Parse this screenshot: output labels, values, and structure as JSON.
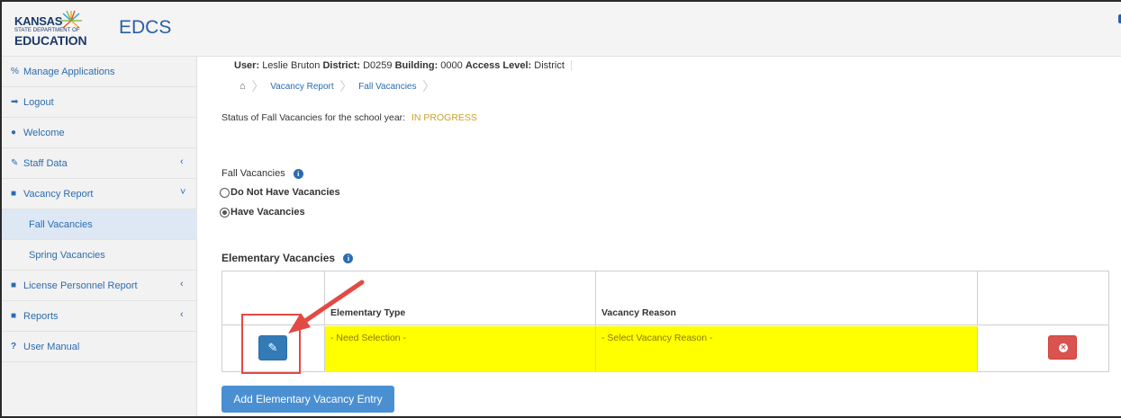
{
  "header": {
    "logo": {
      "line1": "KANSAS",
      "line2": "STATE DEPARTMENT OF",
      "line3": "EDUCATION"
    },
    "app_title": "EDCS"
  },
  "sidebar": {
    "items": [
      {
        "label": "Manage Applications",
        "icon": "link-icon"
      },
      {
        "label": "Logout",
        "icon": "sign-out-icon"
      },
      {
        "label": "Welcome",
        "icon": "users-icon"
      },
      {
        "label": "Staff Data",
        "icon": "pencil-icon",
        "chevron": "‹"
      },
      {
        "label": "Vacancy Report",
        "icon": "folder-icon",
        "chevron": "˅"
      },
      {
        "label": "Fall Vacancies",
        "active": true
      },
      {
        "label": "Spring Vacancies"
      },
      {
        "label": "License Personnel Report",
        "icon": "folder-icon",
        "chevron": "‹"
      },
      {
        "label": "Reports",
        "icon": "folder-icon",
        "chevron": "‹"
      },
      {
        "label": "User Manual",
        "icon": "question-icon"
      }
    ]
  },
  "userinfo": {
    "user_label": "User:",
    "user_value": "Leslie Bruton",
    "district_label": "District:",
    "district_value": "D0259",
    "building_label": "Building:",
    "building_value": "0000",
    "access_label": "Access Level:",
    "access_value": "District"
  },
  "breadcrumb": {
    "items": [
      "Vacancy Report",
      "Fall Vacancies"
    ]
  },
  "status": {
    "label": "Status of Fall Vacancies for the school year:",
    "value": "IN PROGRESS"
  },
  "fall_vacancies": {
    "label": "Fall Vacancies",
    "options": [
      {
        "label": "Do Not Have Vacancies",
        "checked": false
      },
      {
        "label": "Have Vacancies",
        "checked": true
      }
    ]
  },
  "elementary": {
    "title": "Elementary Vacancies",
    "columns": [
      "",
      "Elementary Type",
      "Vacancy Reason",
      ""
    ],
    "rows": [
      {
        "type": "- Need Selection -",
        "reason": "- Select Vacancy Reason -"
      }
    ],
    "add_button": "Add Elementary Vacancy Entry"
  },
  "colors": {
    "accent": "#337ab7",
    "highlight": "#ffff00",
    "danger": "#d9534f",
    "annotation": "#e24a43",
    "status": "#c9a227"
  }
}
